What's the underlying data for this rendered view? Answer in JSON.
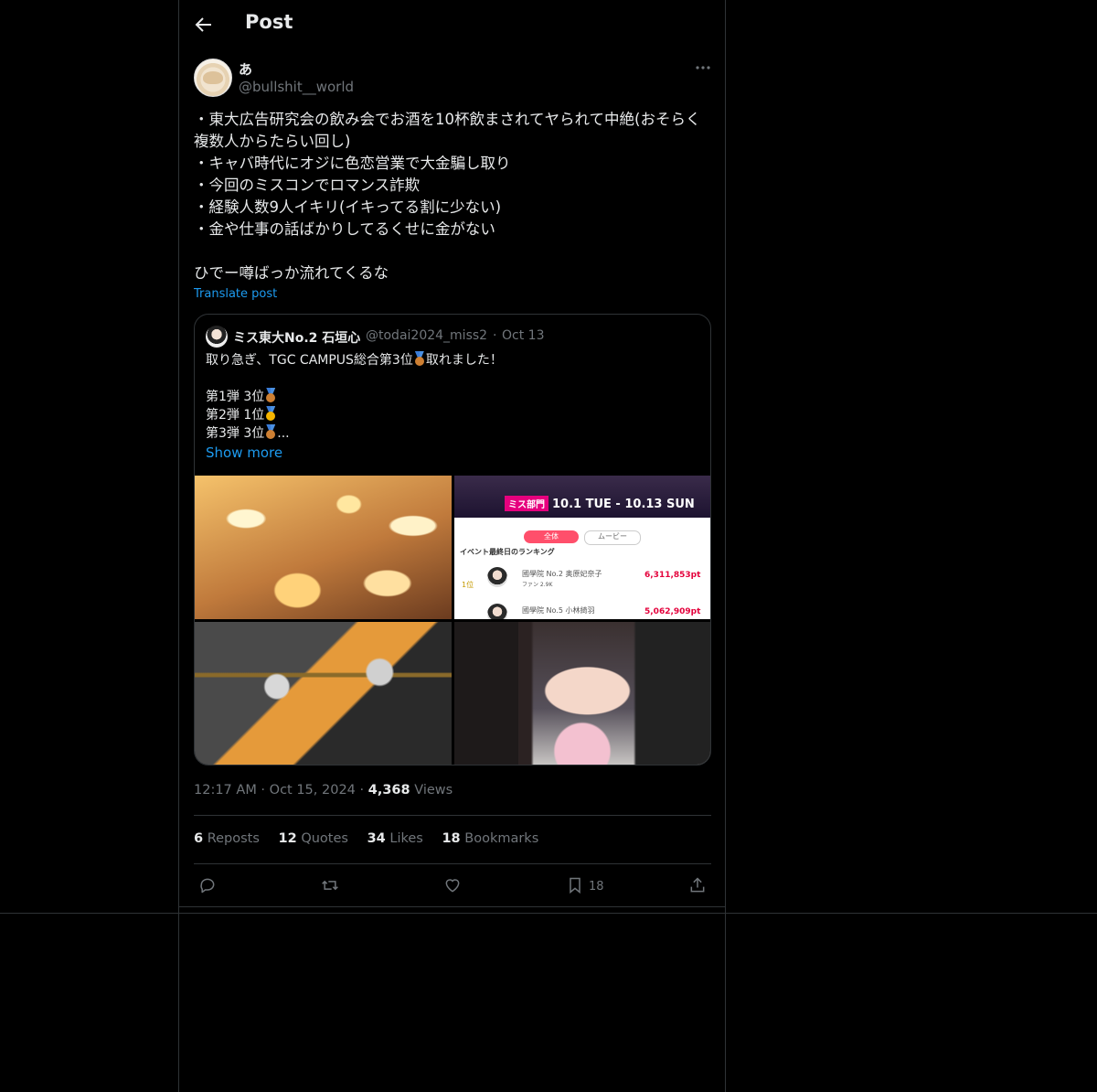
{
  "header": {
    "title": "Post"
  },
  "post": {
    "author_name": "あ",
    "author_handle": "@bullshit__world",
    "text": "・東大広告研究会の飲み会でお酒を10杯飲まされてヤられて中絶(おそらく複数人からたらい回し)\n・キャバ時代にオジに色恋営業で大金騙し取り\n・今回のミスコンでロマンス詐欺\n・経験人数9人イキリ(イキってる割に少ない)\n・金や仕事の話ばかりしてるくせに金がない\n\nひでー噂ばっか流れてくるな",
    "translate": "Translate post",
    "timestamp": "12:17 AM · Oct 15, 2024 ·",
    "views_count": "4,368",
    "views_label": "Views"
  },
  "quote": {
    "name": "ミス東大No.2 石垣心",
    "handle": "@todai2024_miss2",
    "dot": "·",
    "date": "Oct 13",
    "line1_a": "取り急ぎ、TGC CAMPUS総合第3位",
    "line1_b": "取れました！",
    "line2": "第1弾 3位",
    "line3": "第2弾 1位",
    "line4": "第3弾 3位",
    "line4_suffix": "...",
    "show_more": "Show more"
  },
  "ranking_image": {
    "tag": "ミス部門",
    "dates": "10.1 TUE - 10.13 SUN",
    "tab_all": "全体",
    "tab_movie": "ムービー",
    "ranking_title": "イベント最終日のランキング",
    "rows": [
      {
        "rank": "1位",
        "name": "國學院 No.2 奥原妃奈子",
        "fans": "ファン 2.9K",
        "points": "6,311,853pt"
      },
      {
        "rank": "",
        "name": "國學院 No.5 小林綺羽",
        "fans": "",
        "points": "5,062,909pt"
      }
    ]
  },
  "stats": [
    {
      "count": "6",
      "label": "Reposts"
    },
    {
      "count": "12",
      "label": "Quotes"
    },
    {
      "count": "34",
      "label": "Likes"
    },
    {
      "count": "18",
      "label": "Bookmarks"
    }
  ],
  "actions": {
    "bookmark_count": "18"
  },
  "colors": {
    "accent": "#1d9bf0",
    "background": "#000000",
    "muted": "#71767b",
    "border": "#2f3336"
  },
  "icons": [
    "back-arrow-icon",
    "more-icon",
    "reply-icon",
    "repost-icon",
    "like-icon",
    "bookmark-icon",
    "share-icon"
  ]
}
